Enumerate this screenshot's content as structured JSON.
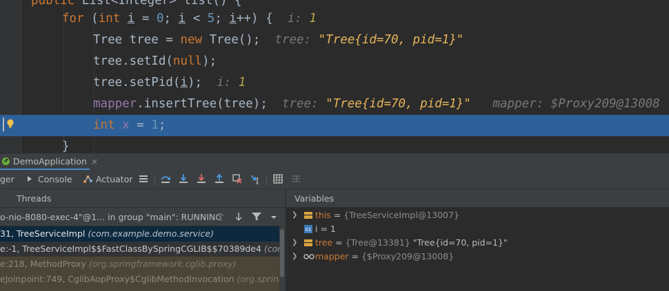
{
  "editor": {
    "lines": [
      {
        "parts": [
          {
            "t": "public ",
            "c": "kw"
          },
          {
            "t": "List<Integer> ",
            "c": ""
          },
          {
            "t": "list",
            "c": ""
          },
          {
            "t": "() {",
            "c": ""
          }
        ]
      },
      {
        "parts": [
          {
            "t": "for",
            "c": "kw"
          },
          {
            "t": " (",
            "c": ""
          },
          {
            "t": "int",
            "c": "kw"
          },
          {
            "t": " ",
            "c": ""
          },
          {
            "t": "i",
            "c": "var-u"
          },
          {
            "t": " = ",
            "c": ""
          },
          {
            "t": "0",
            "c": "num"
          },
          {
            "t": "; ",
            "c": ""
          },
          {
            "t": "i",
            "c": "var-u"
          },
          {
            "t": " < ",
            "c": ""
          },
          {
            "t": "5",
            "c": "num"
          },
          {
            "t": "; ",
            "c": ""
          },
          {
            "t": "i",
            "c": "var-u"
          },
          {
            "t": "++) {  ",
            "c": ""
          },
          {
            "t": "i: ",
            "c": "hint"
          },
          {
            "t": "1",
            "c": "hint-num"
          }
        ]
      },
      {
        "parts": [
          {
            "t": "Tree tree = ",
            "c": ""
          },
          {
            "t": "new",
            "c": "kw"
          },
          {
            "t": " Tree();  ",
            "c": ""
          },
          {
            "t": "tree: ",
            "c": "hint"
          },
          {
            "t": "\"Tree{id=70, pid=1}\"",
            "c": "hint-str"
          }
        ]
      },
      {
        "parts": [
          {
            "t": "tree.setId(",
            "c": ""
          },
          {
            "t": "null",
            "c": "kw"
          },
          {
            "t": ");",
            "c": ""
          }
        ]
      },
      {
        "parts": [
          {
            "t": "tree.setPid(",
            "c": ""
          },
          {
            "t": "i",
            "c": "var-u"
          },
          {
            "t": ");  ",
            "c": ""
          },
          {
            "t": "i: ",
            "c": "hint"
          },
          {
            "t": "1",
            "c": "hint-num"
          }
        ]
      },
      {
        "parts": [
          {
            "t": "mapper",
            "c": "field"
          },
          {
            "t": ".insertTree(tree);  ",
            "c": ""
          },
          {
            "t": "tree: ",
            "c": "hint"
          },
          {
            "t": "\"Tree{id=70, pid=1}\"",
            "c": "hint-str"
          },
          {
            "t": "   mapper: ",
            "c": "hint"
          },
          {
            "t": "$Proxy209@13008",
            "c": "hint"
          }
        ]
      },
      {
        "parts": [
          {
            "t": "int",
            "c": "kw"
          },
          {
            "t": " ",
            "c": ""
          },
          {
            "t": "x",
            "c": "field"
          },
          {
            "t": " = ",
            "c": ""
          },
          {
            "t": "1",
            "c": "num"
          },
          {
            "t": ";",
            "c": ""
          }
        ]
      },
      {
        "parts": [
          {
            "t": "}",
            "c": ""
          }
        ]
      }
    ]
  },
  "tool_window": {
    "tab_label": "DemoApplication",
    "close_glyph": "×"
  },
  "toolbar": {
    "debugger_label": "ger",
    "console_label": "Console",
    "actuator_label": "Actuator"
  },
  "threads": {
    "header": "Threads",
    "selector": "o-nio-8080-exec-4\"@1... in group \"main\": RUNNING"
  },
  "frames": [
    {
      "text": "31, TreeServiceImpl ",
      "pkg": "(com.example.demo.service)",
      "kind": "sel"
    },
    {
      "text": "e:-1, TreeServiceImpl$$FastClassBySpringCGLIB$$70389de4 ",
      "pkg": "(com.exam",
      "kind": "normal"
    },
    {
      "text": "e:218, MethodProxy ",
      "pkg": "(org.springframework.cglib.proxy)",
      "kind": "lib"
    },
    {
      "text": "eJoinpoint:749, CglibAopProxy$CglibMethodInvocation ",
      "pkg": "(org.springfram",
      "kind": "lib"
    },
    {
      "text": "",
      "pkg": "",
      "kind": "lib"
    }
  ],
  "variables": {
    "header": "Variables",
    "items": [
      {
        "name": "this",
        "type": "{TreeServiceImpl@13007}",
        "value": "",
        "expandable": true,
        "icon": "field-icon",
        "name_style": "field"
      },
      {
        "name": "i",
        "type": "",
        "value": "= 1",
        "expandable": false,
        "icon": "primitive-icon",
        "name_style": "plain"
      },
      {
        "name": "tree",
        "type": "{Tree@13381}",
        "value": "\"Tree{id=70, pid=1}\"",
        "expandable": true,
        "icon": "field-icon",
        "name_style": "field"
      },
      {
        "name": "mapper",
        "type": "{$Proxy209@13008}",
        "value": "",
        "expandable": true,
        "icon": "watch-icon",
        "name_style": "field"
      }
    ]
  },
  "colors": {
    "accent": "#2d6099",
    "keyword": "#cc7832",
    "number": "#6897bb",
    "field": "#9876aa",
    "hint_string": "#e7b45a"
  }
}
